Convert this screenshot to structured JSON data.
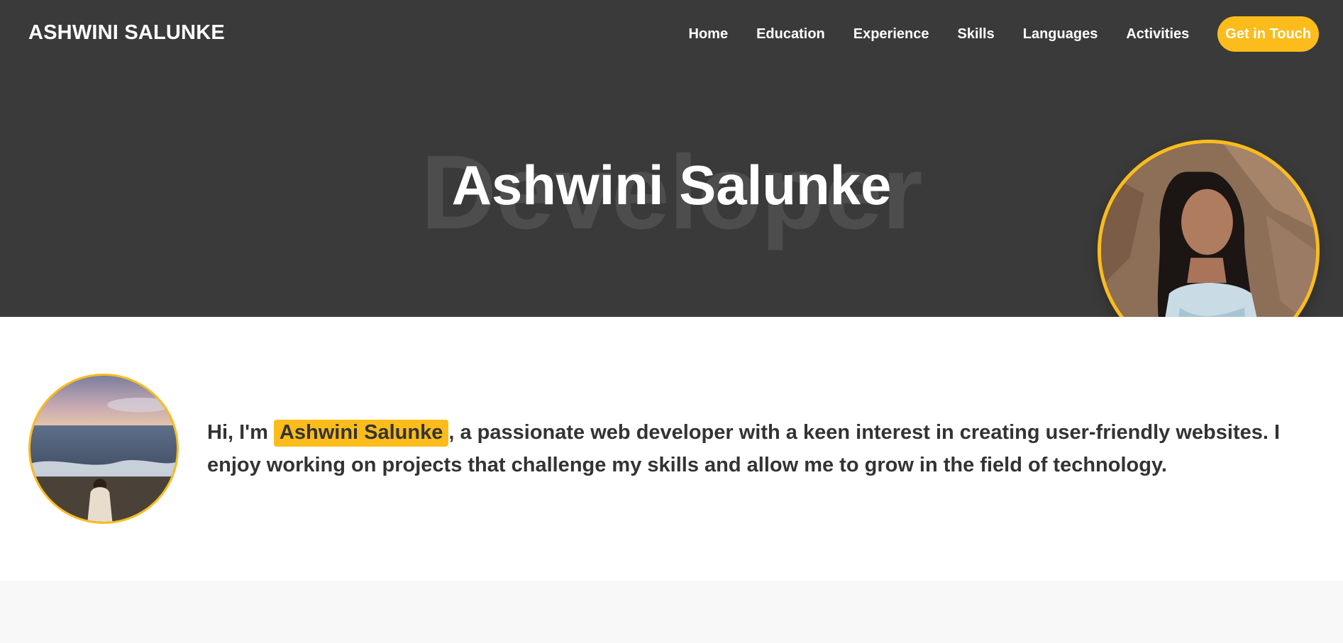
{
  "header": {
    "brand": "ASHWINI SALUNKE",
    "nav": [
      "Home",
      "Education",
      "Experience",
      "Skills",
      "Languages",
      "Activities"
    ],
    "cta": "Get in Touch"
  },
  "hero": {
    "background_word": "Developer",
    "title": "Ashwini Salunke"
  },
  "about": {
    "greeting": "Hi, I'm",
    "name": "Ashwini Salunke",
    "text": ", a passionate web developer with a keen interest in creating user-friendly websites. I enjoy working on projects that challenge my skills and allow me to grow in the field of technology."
  },
  "colors": {
    "accent": "#fbbc1c",
    "hero_bg": "#3a3a3a",
    "text": "#333333"
  }
}
